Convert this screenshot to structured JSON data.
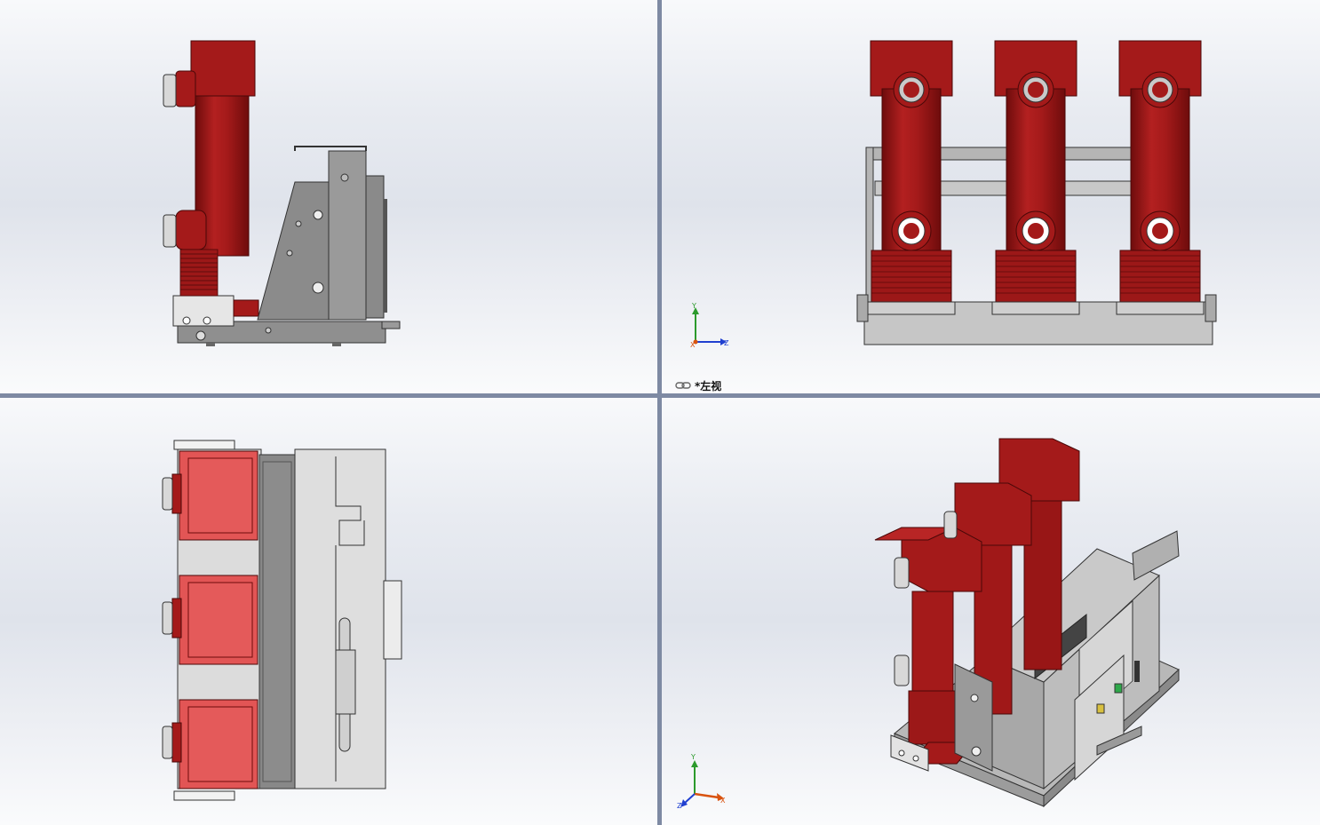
{
  "viewports": [
    {
      "id": "front",
      "has_triad": false
    },
    {
      "id": "left",
      "has_triad": true,
      "active": true
    },
    {
      "id": "top",
      "has_triad": false
    },
    {
      "id": "isometric",
      "has_triad": true
    }
  ],
  "active_view": {
    "label": "*左视",
    "icon": "link-icon"
  },
  "triad": {
    "x": "X",
    "y": "Y",
    "z": "Z"
  },
  "colors": {
    "insulator_red": "#a41a1a",
    "insulator_dark": "#7d0f0f",
    "top_face_red": "#e25555",
    "steel_gray": "#8a8a8a",
    "panel_light": "#dcdcdc",
    "splitter": "#7e8aa3",
    "axis_x": "#d9530f",
    "axis_y": "#2c9a2c",
    "axis_z": "#2040d0"
  }
}
